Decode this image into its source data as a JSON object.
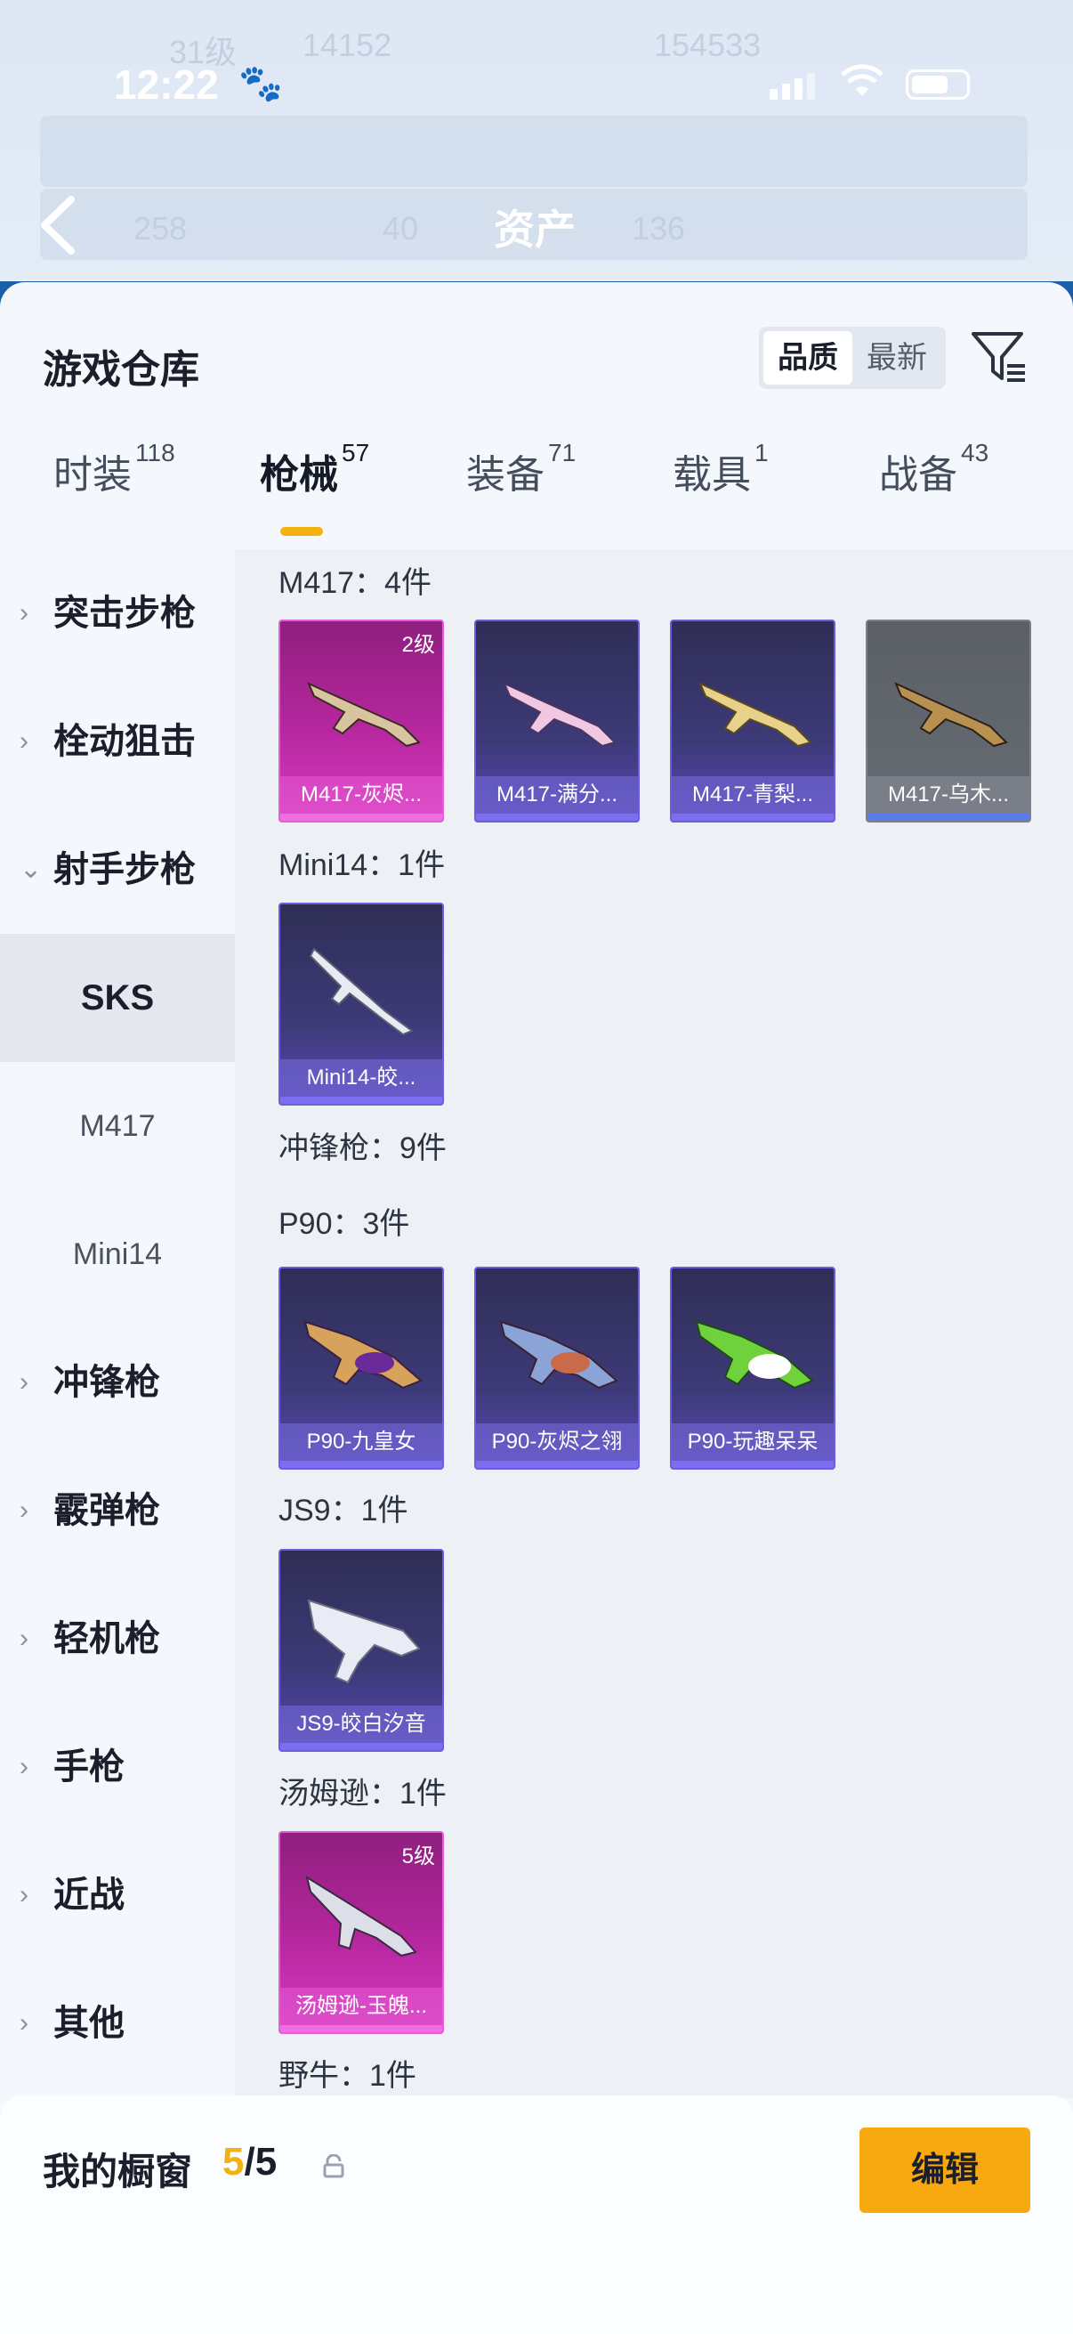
{
  "status_bar": {
    "time": "12:22"
  },
  "header": {
    "title": "资产",
    "bg_texts": [
      "31级",
      "14152",
      "154533",
      "258",
      "40",
      "136"
    ]
  },
  "panel": {
    "title": "游戏仓库",
    "sort": {
      "quality": "品质",
      "newest": "最新"
    }
  },
  "tabs": [
    {
      "label": "时装",
      "count": "118"
    },
    {
      "label": "枪械",
      "count": "57"
    },
    {
      "label": "装备",
      "count": "71"
    },
    {
      "label": "载具",
      "count": "1"
    },
    {
      "label": "战备",
      "count": "43"
    }
  ],
  "sidebar": {
    "items": [
      {
        "label": "突击步枪"
      },
      {
        "label": "栓动狙击"
      },
      {
        "label": "射手步枪"
      },
      {
        "label": "SKS"
      },
      {
        "label": "M417"
      },
      {
        "label": "Mini14"
      },
      {
        "label": "冲锋枪"
      },
      {
        "label": "霰弹枪"
      },
      {
        "label": "轻机枪"
      },
      {
        "label": "手枪"
      },
      {
        "label": "近战"
      },
      {
        "label": "其他"
      }
    ]
  },
  "groups": [
    {
      "title": "M417：4件",
      "cards": [
        {
          "name": "M417-灰烬...",
          "level": "2级"
        },
        {
          "name": "M417-满分..."
        },
        {
          "name": "M417-青梨..."
        },
        {
          "name": "M417-乌木..."
        }
      ]
    },
    {
      "title": "Mini14：1件",
      "cards": [
        {
          "name": "Mini14-皎..."
        }
      ]
    },
    {
      "title": "冲锋枪：9件"
    },
    {
      "title": "P90：3件",
      "cards": [
        {
          "name": "P90-九皇女"
        },
        {
          "name": "P90-灰烬之翎"
        },
        {
          "name": "P90-玩趣呆呆"
        }
      ]
    },
    {
      "title": "JS9：1件",
      "cards": [
        {
          "name": "JS9-皎白汐音"
        }
      ]
    },
    {
      "title": "汤姆逊：1件",
      "cards": [
        {
          "name": "汤姆逊-玉魄...",
          "level": "5级"
        }
      ]
    },
    {
      "title": "野牛：1件"
    }
  ],
  "footer": {
    "title": "我的橱窗",
    "count_current": "5",
    "count_sep": "/",
    "count_total": "5",
    "edit": "编辑"
  },
  "colors": {
    "accent": "#f8a90f",
    "purple_card": "#3d3a78",
    "pink_card": "#b7279f"
  }
}
